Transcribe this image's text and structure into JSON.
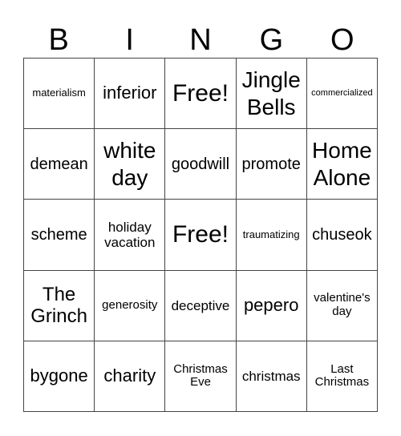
{
  "header": [
    "B",
    "I",
    "N",
    "G",
    "O"
  ],
  "cells": [
    [
      "materialism",
      "inferior",
      "Free!",
      "Jingle Bells",
      "commercialized"
    ],
    [
      "demean",
      "white day",
      "goodwill",
      "promote",
      "Home Alone"
    ],
    [
      "scheme",
      "holiday vacation",
      "Free!",
      "traumatizing",
      "chuseok"
    ],
    [
      "The Grinch",
      "generosity",
      "deceptive",
      "pepero",
      "valentine's day"
    ],
    [
      "bygone",
      "charity",
      "Christmas Eve",
      "christmas",
      "Last Christmas"
    ]
  ]
}
